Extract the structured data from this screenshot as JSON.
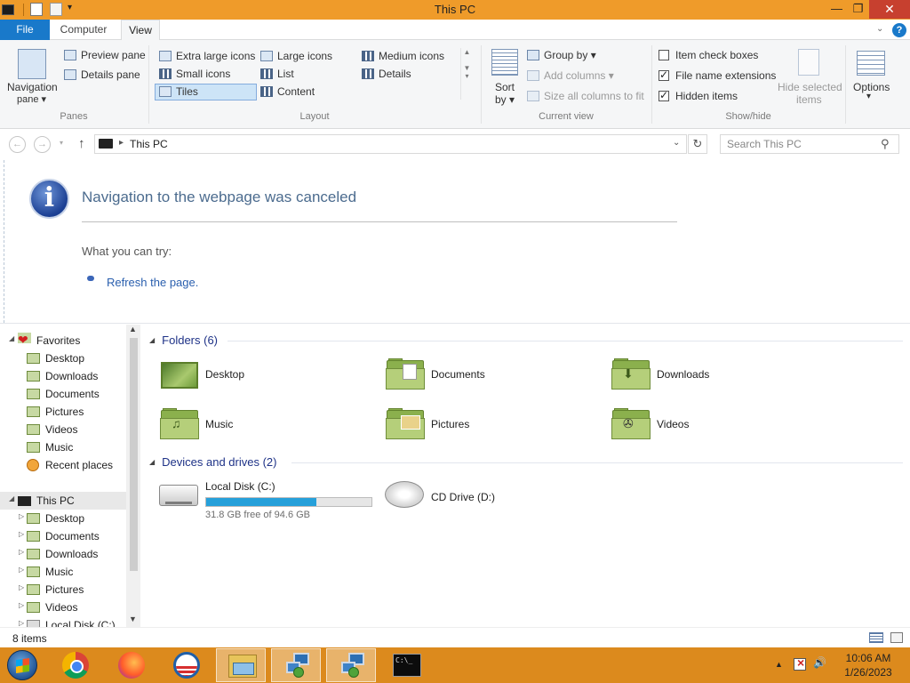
{
  "window": {
    "title": "This PC",
    "controls": {
      "minimize": "—",
      "maximize": "❐",
      "close": "✕"
    }
  },
  "ribbon_tabs": {
    "file": "File",
    "computer": "Computer",
    "view": "View",
    "help": "?"
  },
  "ribbon": {
    "panes": {
      "navigation_pane": "Navigation",
      "navigation_pane_sub": "pane ▾",
      "preview_pane": "Preview pane",
      "details_pane": "Details pane",
      "label": "Panes"
    },
    "layout": {
      "extra_large_icons": "Extra large icons",
      "large_icons": "Large icons",
      "medium_icons": "Medium icons",
      "small_icons": "Small icons",
      "list": "List",
      "details": "Details",
      "tiles": "Tiles",
      "content": "Content",
      "label": "Layout"
    },
    "current_view": {
      "sort_by": "Sort",
      "sort_by_sub": "by ▾",
      "group_by": "Group by ▾",
      "add_columns": "Add columns ▾",
      "size_all_columns": "Size all columns to fit",
      "label": "Current view"
    },
    "show_hide": {
      "item_check_boxes": "Item check boxes",
      "file_name_extensions": "File name extensions",
      "hidden_items": "Hidden items",
      "hide_selected": "Hide selected",
      "hide_selected_sub": "items",
      "label": "Show/hide"
    },
    "options": {
      "label": "Options",
      "sub": "▾"
    }
  },
  "address": {
    "path": "This PC",
    "search_placeholder": "Search This PC"
  },
  "info_panel": {
    "title": "Navigation to the webpage was canceled",
    "try_text": "What you can try:",
    "refresh_link": "Refresh the page."
  },
  "nav_pane": {
    "favorites": "Favorites",
    "favorites_items": [
      "Desktop",
      "Downloads",
      "Documents",
      "Pictures",
      "Videos",
      "Music",
      "Recent places"
    ],
    "this_pc": "This PC",
    "this_pc_items": [
      "Desktop",
      "Documents",
      "Downloads",
      "Music",
      "Pictures",
      "Videos",
      "Local Disk (C:)"
    ]
  },
  "content": {
    "folders_header": "Folders (6)",
    "folders": [
      "Desktop",
      "Documents",
      "Downloads",
      "Music",
      "Pictures",
      "Videos"
    ],
    "drives_header": "Devices and drives (2)",
    "drives": [
      {
        "name": "Local Disk (C:)",
        "free": "31.8 GB free of 94.6 GB",
        "used_fraction": 0.664
      },
      {
        "name": "CD Drive (D:)"
      }
    ]
  },
  "status": {
    "item_count": "8 items"
  },
  "taskbar": {
    "clock_time": "10:06 AM",
    "clock_date": "1/26/2023",
    "tray_up": "▲",
    "tray_volume": "🔊"
  }
}
